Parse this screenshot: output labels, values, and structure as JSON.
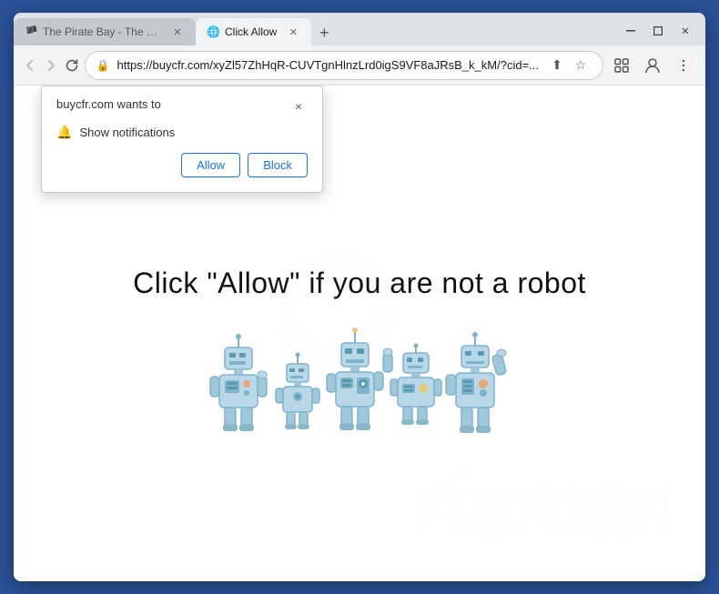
{
  "browser": {
    "tabs": [
      {
        "id": "tab1",
        "label": "The Pirate Bay - The galaxy's mo...",
        "favicon": "🏴",
        "active": false
      },
      {
        "id": "tab2",
        "label": "Click Allow",
        "favicon": "🌐",
        "active": true
      }
    ],
    "new_tab_label": "+",
    "window_controls": {
      "minimize": "🗕",
      "maximize": "🗖",
      "close": "✕"
    },
    "nav": {
      "back": "←",
      "forward": "→",
      "reload": "↻",
      "lock_icon": "🔒",
      "address": "https://buycfr.com/xyZl57ZhHqR-CUVTgnHlnzLrd0igS9VF8aJRsB_k_kM/?cid=...",
      "share_icon": "⬆",
      "star_icon": "☆",
      "tab_icon": "⬜",
      "profile_icon": "👤",
      "menu_icon": "⋮"
    }
  },
  "notification_popup": {
    "title": "buycfr.com wants to",
    "close_label": "×",
    "permission": {
      "icon": "🔔",
      "text": "Show notifications"
    },
    "buttons": {
      "allow": "Allow",
      "block": "Block"
    }
  },
  "page": {
    "main_text": "Click \"Allow\"   if you are not   a robot",
    "watermark_text": "rismam"
  }
}
